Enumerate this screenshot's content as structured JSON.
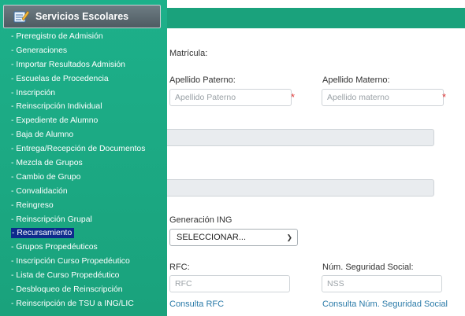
{
  "sidebar": {
    "title": "Servicios Escolares",
    "items": [
      {
        "label": "- Preregistro de Admisión"
      },
      {
        "label": "- Generaciones"
      },
      {
        "label": "- Importar Resultados Admisión"
      },
      {
        "label": "- Escuelas de Procedencia"
      },
      {
        "label": "- Inscripción"
      },
      {
        "label": "- Reinscripción Individual"
      },
      {
        "label": "- Expediente de Alumno"
      },
      {
        "label": "- Baja de Alumno"
      },
      {
        "label": "- Entrega/Recepción de Documentos"
      },
      {
        "label": "- Mezcla de Grupos"
      },
      {
        "label": "- Cambio de Grupo"
      },
      {
        "label": "- Convalidación"
      },
      {
        "label": "- Reingreso"
      },
      {
        "label": "- Reinscripción Grupal"
      },
      {
        "label": "- Recursamiento",
        "active": true
      },
      {
        "label": "- Grupos Propedéuticos"
      },
      {
        "label": "- Inscripción Curso Propedéutico"
      },
      {
        "label": "- Lista de Curso Propedéutico"
      },
      {
        "label": "- Desbloqueo de Reinscripción"
      },
      {
        "label": "- Reinscripción de TSU a ING/LIC"
      }
    ]
  },
  "form": {
    "matricula_label": "Matrícula:",
    "apellido_paterno_label": "Apellido Paterno:",
    "apellido_paterno_placeholder": "Apellido Paterno",
    "apellido_materno_label": "Apellido Materno:",
    "apellido_materno_placeholder": "Apellido materno",
    "required_mark": "*",
    "generacion_label": "Generación ING",
    "generacion_value": "SELECCIONAR...",
    "rfc_label": "RFC:",
    "rfc_placeholder": "RFC",
    "nss_label": "Núm. Seguridad Social:",
    "nss_placeholder": "NSS",
    "consulta_rfc": "Consulta RFC",
    "consulta_nss": "Consulta Núm. Seguridad Social"
  },
  "colors": {
    "sidebar_bg": "#1db08a",
    "topbar_bg": "#1aa27c",
    "active_item_bg": "#0d2a8c",
    "link": "#2a7aa8",
    "required": "#e03a3a"
  },
  "icons": {
    "menu_head": "notebook-pencil-icon",
    "select": "chevron-down-icon"
  }
}
